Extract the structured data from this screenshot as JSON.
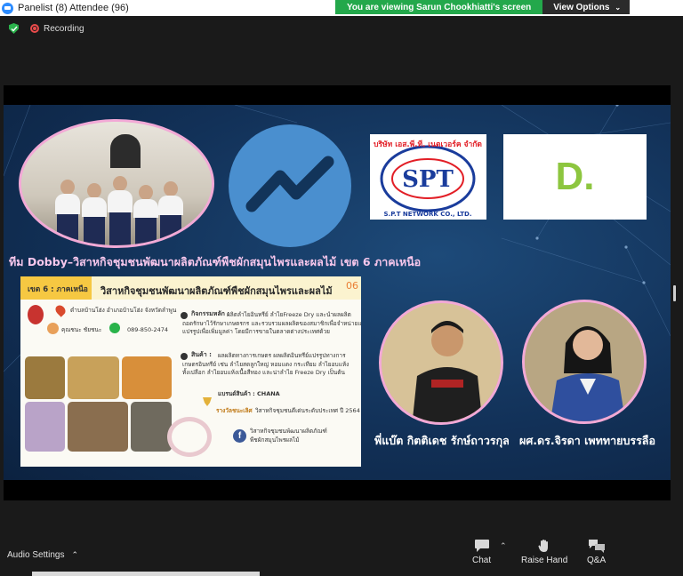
{
  "window": {
    "title": "Panelist (8) Attendee (96)"
  },
  "banner": {
    "viewing_text": "You are viewing Sarun Chookhiatti's screen",
    "view_options_label": "View Options",
    "accent_green": "#23a84b"
  },
  "status": {
    "recording_label": "Recording",
    "icons": [
      "shield-check-icon",
      "record-icon"
    ]
  },
  "slide": {
    "team_title": "ทีม Dobby–วิสาหกิจชุมชนพัฒนาผลิตภัณฑ์พืชผักสมุนไพรและผลไม้ เขต 6 ภาคเหนือ",
    "spt_logo": {
      "line1": "บริษัท เอส.พี.ที. เนตเวอร์ค จำกัด",
      "mark": "SPT",
      "line2": "S.P.T NETWORK CO., LTD."
    },
    "d_logo_text": "D.",
    "poster": {
      "zone": "เขต 6 : ภาคเหนือ",
      "title": "วิสาหกิจชุมชนพัฒนาผลิตภัณฑ์พืชผักสมุนไพรและผลไม้",
      "number": "06",
      "address": "ตำบลบ้านโฮ่ง อำเภอบ้านโฮ่ง จังหวัดลำพูน",
      "contact_name": "คุณชนะ ชัยชนะ",
      "phone": "089-850-2474",
      "main_activity_label": "กิจกรรมหลัก :",
      "main_activity_text": "ผลิตลำไยอินทรีย์ ลำไยFreeze Dry และนำผลผลิต",
      "main_activity_text2": "ถอดรักษาไว้รักษาเกษตรกร และรวบรวมผลผลิตของสมาชิกเพื่อจำหน่ายและ",
      "main_activity_text3": "แปรรูปเพื่อเพิ่มมูลค่า โดยมีการขายในตลาดต่างประเทศด้วย",
      "products_label": "สินค้า :",
      "products_text": "ผลผลิตทางการเกษตร ผลผลิตอินทรีย์แปรรูปทางการ",
      "products_text2": "เกษตรอินทรีย์ เช่น ลำไยสดลูกใหญ่ หอมแดง กระเทียม ลำไยอบแห้ง",
      "products_text3": "ทั้งเปลือก ลำไยอบแห้งเนื้อสีทอง และน่าลำไย Freeze Dry เป็นต้น",
      "brand": "แบรนด์สินค้า : CHANA",
      "award_label": "รางวัลชนะเลิศ",
      "award_text": "วิสาหกิจชุมชนดีเด่นระดับประเทศ ปี 2564",
      "fb_text": "วิสาหกิจชุมชนพัฒนาผลิตภัณฑ์",
      "fb_text2": "พืชผักสมุนไพรผลไม้"
    },
    "speaker1": {
      "name": "พี่แบ๊ต กิตติเดช รักษ์ถาวรกุล"
    },
    "speaker2": {
      "name": "ผศ.ดร.จิรดา  เพททายบรรลือ"
    },
    "colors": {
      "background": "#123158",
      "frame_pink": "#f2a9d6",
      "title_pink": "#f7c7ec",
      "logo_blue": "#4a8fcf",
      "d_green": "#8dc63f"
    }
  },
  "toolbar": {
    "audio_settings_label": "Audio Settings",
    "chat_label": "Chat",
    "raise_hand_label": "Raise Hand",
    "qa_label": "Q&A",
    "icons": [
      "chat-icon",
      "raise-hand-icon",
      "qa-icon"
    ]
  }
}
